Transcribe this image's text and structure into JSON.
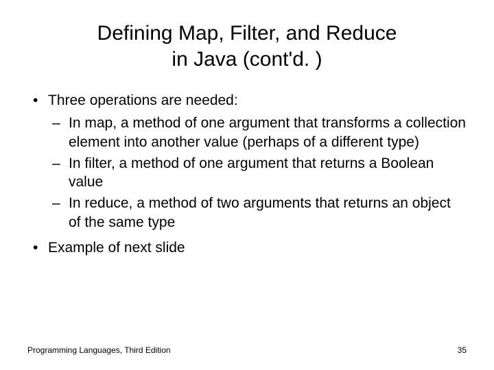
{
  "title_line1": "Defining Map, Filter, and Reduce",
  "title_line2": "in Java (cont'd. )",
  "bullets": {
    "b1": "Three operations are needed:",
    "b1_sub1": "In map, a method of one argument that transforms a collection element into another value (perhaps of a different type)",
    "b1_sub2": "In filter, a method of one argument that returns a Boolean value",
    "b1_sub3": "In reduce, a method of two arguments that returns an object of the same type",
    "b2": "Example of next slide"
  },
  "footer_left": "Programming Languages, Third Edition",
  "footer_right": "35"
}
